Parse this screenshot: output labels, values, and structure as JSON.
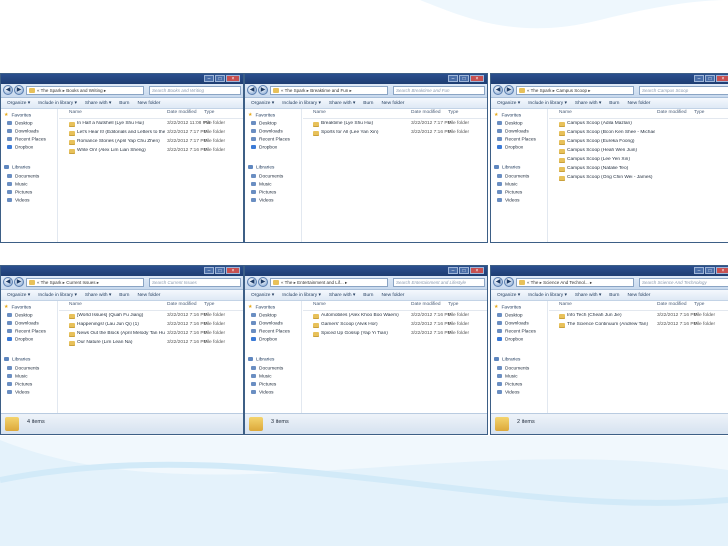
{
  "toolbar": {
    "organize": "Organize ▾",
    "include": "Include in library ▾",
    "share": "Share with ▾",
    "burn": "Burn",
    "new_folder": "New folder"
  },
  "columns": {
    "name": "Name",
    "date": "Date modified",
    "type": "Type"
  },
  "nav": {
    "favorites": "Favorites",
    "desktop": "Desktop",
    "downloads": "Downloads",
    "recent": "Recent Places",
    "dropbox": "Dropbox",
    "libraries": "Libraries",
    "documents": "Documents",
    "music": "Music",
    "pictures": "Pictures",
    "videos": "Videos"
  },
  "windows": [
    {
      "path": "« The Spark ▸ Books and Writing ▸",
      "search": "Search Books and Writing",
      "status": "",
      "items": [
        {
          "name": "In Half a Nutshell (Lye Shu Hui)",
          "date": "3/22/2012 11:08 PM",
          "type": "File folder"
        },
        {
          "name": "Let's Hear It! (Editorials and Letters to the...",
          "date": "3/22/2012 7:17 PM",
          "type": "File folder"
        },
        {
          "name": "Romance Stories (April Yap Chu Zhen)",
          "date": "3/22/2012 7:17 PM",
          "type": "File folder"
        },
        {
          "name": "Write On! (Alex Lim Lian Sheng)",
          "date": "3/22/2012 7:16 PM",
          "type": "File folder"
        }
      ]
    },
    {
      "path": "« The Spark ▸ Breaktime and Fun ▸",
      "search": "Search Breaktime and Fun",
      "status": "",
      "items": [
        {
          "name": "Breaktime (Lye Shu Hui)",
          "date": "3/22/2012 7:17 PM",
          "type": "File folder"
        },
        {
          "name": "Sports for All (Lee Yan Xin)",
          "date": "3/22/2012 7:16 PM",
          "type": "File folder"
        }
      ]
    },
    {
      "path": "« The Spark ▸ Campus Scoop ▸",
      "search": "Search Campus Scoop",
      "status": "",
      "items": [
        {
          "name": "Campus Scoop (Adila Mazlan)",
          "date": "",
          "type": ""
        },
        {
          "name": "Campus Scoop (Bcon Ken Shee - Michael)",
          "date": "",
          "type": ""
        },
        {
          "name": "Campus Scoop (Eureka Foong)",
          "date": "",
          "type": ""
        },
        {
          "name": "Campus Scoop (Heah Wen Juin)",
          "date": "",
          "type": ""
        },
        {
          "name": "Campus Scoop (Lee Yen Xin)",
          "date": "",
          "type": ""
        },
        {
          "name": "Campus Scoop (Natalie Teo)",
          "date": "",
          "type": ""
        },
        {
          "name": "Campus Scoop (Ong Chin Wei - James)",
          "date": "",
          "type": ""
        }
      ]
    },
    {
      "path": "« The Spark ▸ Current Issues ▸",
      "search": "Search Current Issues",
      "status": "4 items",
      "items": [
        {
          "name": "[World Issues] (Quah Fu Jiang)",
          "date": "3/22/2012 7:16 PM",
          "type": "File folder"
        },
        {
          "name": "Happenings! (Lau Jun Qi) (1)",
          "date": "3/22/2012 7:16 PM",
          "type": "File folder"
        },
        {
          "name": "News Out the Block (April Melody Tan Hui En)",
          "date": "3/22/2012 7:16 PM",
          "type": "File folder"
        },
        {
          "name": "Our Nature (Lim Lean Na)",
          "date": "3/22/2012 7:16 PM",
          "type": "File folder"
        }
      ]
    },
    {
      "path": "« The ▸ Entertainment and Lif... ▸",
      "search": "Search Entertainment and Lifestyle",
      "status": "3 items",
      "items": [
        {
          "name": "Automobiles (Alex Khoo Boo Waem)",
          "date": "3/22/2012 7:16 PM",
          "type": "File folder"
        },
        {
          "name": "Gamers' Scoop (Alvik Hor)",
          "date": "3/22/2012 7:16 PM",
          "type": "File folder"
        },
        {
          "name": "Spiced Up Gossip (Yap Yi Tian)",
          "date": "3/22/2012 7:16 PM",
          "type": "File folder"
        }
      ]
    },
    {
      "path": "« The ▸ Science And Technol... ▸",
      "search": "Search Science And Technology",
      "status": "2 items",
      "items": [
        {
          "name": "Info Tech (Cheah Jun Jie)",
          "date": "3/22/2012 7:16 PM",
          "type": "File folder"
        },
        {
          "name": "The Science Continuum (Andrew Tan)",
          "date": "3/22/2012 7:16 PM",
          "type": "File folder"
        }
      ]
    }
  ]
}
